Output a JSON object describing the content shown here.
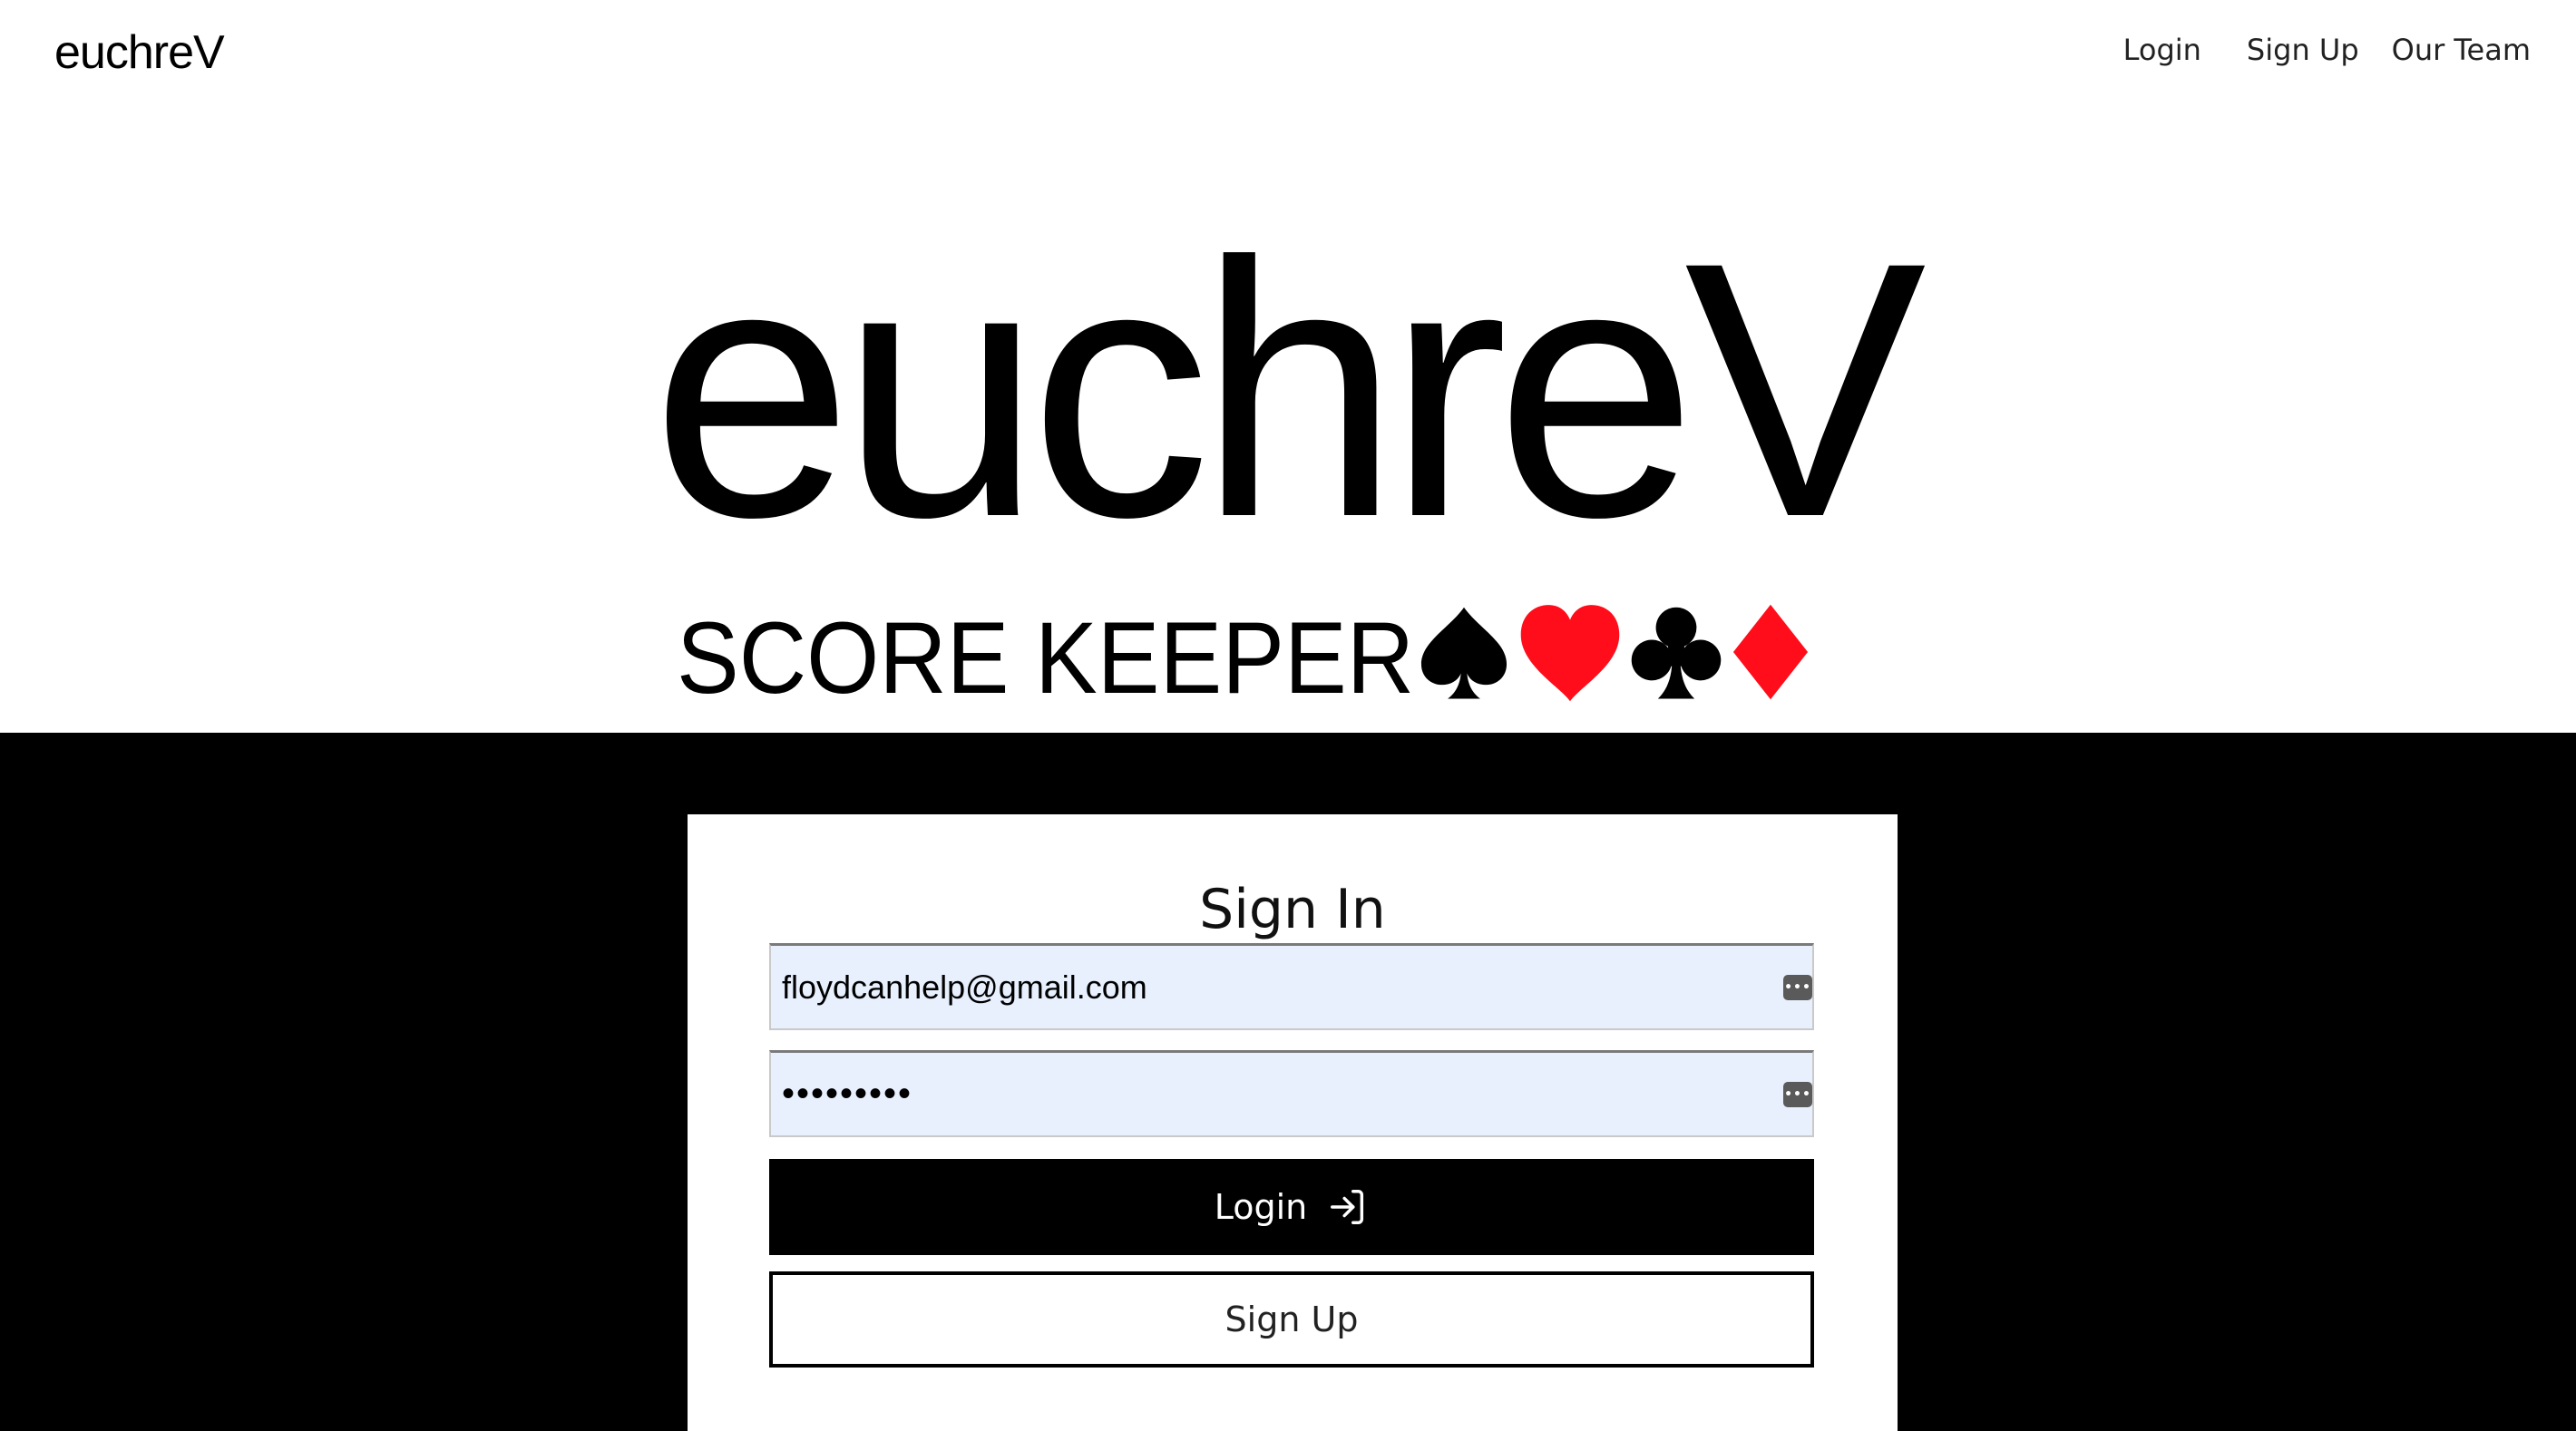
{
  "nav": {
    "brand": "euchreV",
    "links": [
      "Login",
      "Sign Up",
      "Our Team"
    ]
  },
  "hero": {
    "logo_word": "euchreV",
    "logo_subtitle": "SCORE KEEPER",
    "suits": [
      "spade-icon",
      "heart-icon",
      "club-icon",
      "diamond-icon"
    ],
    "suit_colors": {
      "black": "#000000",
      "red": "#ff0d1a"
    }
  },
  "signin": {
    "title": "Sign In",
    "email_value": "floydcanhelp@gmail.com",
    "password_value": "•••••••••",
    "login_label": "Login",
    "signup_label": "Sign Up"
  },
  "colors": {
    "band": "#000000",
    "autofill": "#e8f0fe",
    "primary_button": "#000000"
  }
}
